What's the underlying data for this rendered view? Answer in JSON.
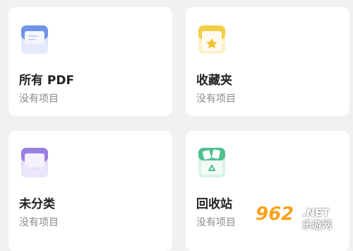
{
  "cards": [
    {
      "title": "所有 PDF",
      "subtitle": "没有项目",
      "icon": "pdf-folder-icon"
    },
    {
      "title": "收藏夹",
      "subtitle": "没有项目",
      "icon": "favorites-folder-icon"
    },
    {
      "title": "未分类",
      "subtitle": "没有项目",
      "icon": "uncategorized-tray-icon"
    },
    {
      "title": "回收站",
      "subtitle": "没有项目",
      "icon": "recycle-bin-icon"
    }
  ],
  "watermark": {
    "number": "962",
    "domain": ".NET",
    "site_name": "乐游网"
  },
  "colors": {
    "background": "#f1f1f3",
    "card": "#ffffff",
    "pdf_icon": "#6f93e6",
    "favorites_icon": "#f2cf45",
    "uncategorized_icon": "#9b7fe3",
    "recycle_icon": "#4fc08d",
    "watermark_accent": "#f7a21b"
  }
}
